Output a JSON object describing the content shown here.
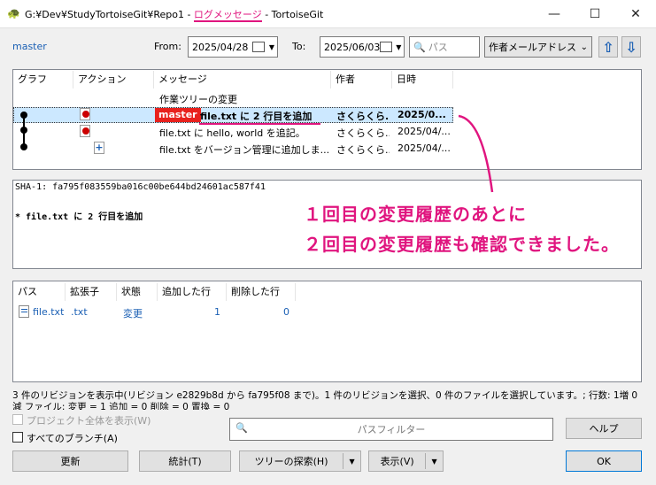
{
  "window": {
    "title_prefix": "G:¥Dev¥StudyTortoiseGit¥Repo1 - ",
    "title_highlight": "ログメッセージ",
    "title_suffix": " - TortoiseGit",
    "minimize": "—",
    "maximize": "☐",
    "close": "✕"
  },
  "toolbar": {
    "branch": "master",
    "from_label": "From:",
    "from_date": "2025/04/28",
    "to_label": "To:",
    "to_date": "2025/06/03",
    "search_placeholder": "パス",
    "filter_select": "作者メールアドレス",
    "up_arrow": "⇧",
    "down_arrow": "⇩"
  },
  "log": {
    "headers": [
      "グラフ",
      "アクション",
      "メッセージ",
      "作者",
      "日時"
    ],
    "working_tree": "作業ツリーの変更",
    "rows": [
      {
        "tag": "master",
        "message": "file.txt に 2 行目を追加",
        "author": "さくらくら...",
        "date": "2025/0..."
      },
      {
        "message": "file.txt に hello, world を追記。",
        "author": "さくらくら...",
        "date": "2025/04/..."
      },
      {
        "message": "file.txt をバージョン管理に追加しま...",
        "author": "さくらくら...",
        "date": "2025/04/..."
      }
    ]
  },
  "detail": {
    "sha": "SHA-1: fa795f083559ba016c00be644bd24601ac587f41",
    "message": "* file.txt に 2 行目を追加"
  },
  "callout": {
    "line1": "１回目の変更履歴のあとに",
    "line2": "２回目の変更履歴も確認できました。"
  },
  "files": {
    "headers": [
      "パス",
      "拡張子",
      "状態",
      "追加した行",
      "削除した行"
    ],
    "rows": [
      {
        "path": "file.txt",
        "ext": ".txt",
        "status": "変更",
        "added": "1",
        "deleted": "0"
      }
    ]
  },
  "status_text": "3 件のリビジョンを表示中(リビジョン e2829b8d から fa795f08 まで)。1 件のリビジョンを選択、0 件のファイルを選択しています。; 行数: 1増 0減  ファイル: 変更 = 1 追加 = 0 削除 = 0 置換 = 0",
  "bottom": {
    "show_whole_project": "プロジェクト全体を表示(W)",
    "all_branches": "すべてのブランチ(A)",
    "path_filter_placeholder": "パスフィルター",
    "help": "ヘルプ",
    "refresh": "更新",
    "statistics": "統計(T)",
    "walk_tree": "ツリーの探索(H)",
    "view": "表示(V)",
    "ok": "OK"
  },
  "colors": {
    "accent": "#e0157f",
    "tag_bg": "#e8211d",
    "selected_row": "#cce8ff",
    "link_blue": "#1a5fb4"
  }
}
